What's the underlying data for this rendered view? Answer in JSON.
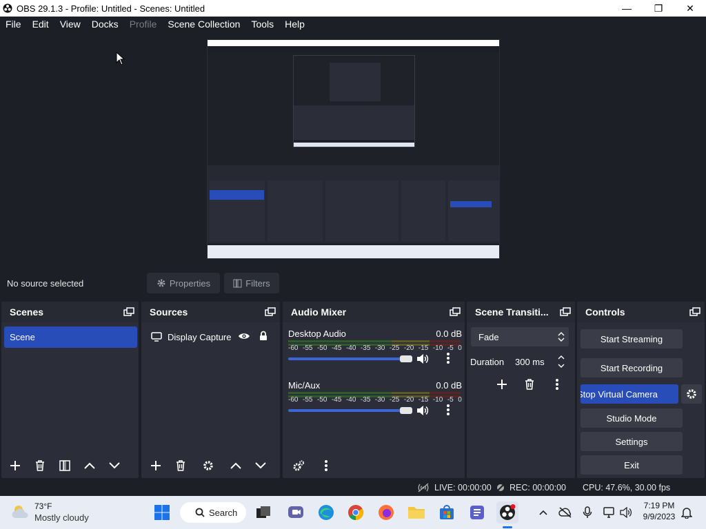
{
  "window": {
    "title": "OBS 29.1.3 - Profile: Untitled - Scenes: Untitled",
    "minimize": "—",
    "maximize": "❐",
    "close": "✕"
  },
  "menubar": {
    "items": [
      {
        "label": "File",
        "enabled": true
      },
      {
        "label": "Edit",
        "enabled": true
      },
      {
        "label": "View",
        "enabled": true
      },
      {
        "label": "Docks",
        "enabled": true
      },
      {
        "label": "Profile",
        "enabled": false
      },
      {
        "label": "Scene Collection",
        "enabled": true
      },
      {
        "label": "Tools",
        "enabled": true
      },
      {
        "label": "Help",
        "enabled": true
      }
    ]
  },
  "sourcebar": {
    "no_source": "No source selected",
    "properties": "Properties",
    "filters": "Filters"
  },
  "scenes": {
    "title": "Scenes",
    "items": [
      "Scene"
    ]
  },
  "sources": {
    "title": "Sources",
    "items": [
      {
        "label": "Display Capture",
        "visible": true,
        "locked": true
      }
    ]
  },
  "audio_mixer": {
    "title": "Audio Mixer",
    "ticks": [
      "-60",
      "-55",
      "-50",
      "-45",
      "-40",
      "-35",
      "-30",
      "-25",
      "-20",
      "-15",
      "-10",
      "-5",
      "0"
    ],
    "channels": [
      {
        "name": "Desktop Audio",
        "db": "0.0 dB",
        "volume": 1.0
      },
      {
        "name": "Mic/Aux",
        "db": "0.0 dB",
        "volume": 1.0
      }
    ]
  },
  "transitions": {
    "title": "Scene Transiti...",
    "selected": "Fade",
    "duration_label": "Duration",
    "duration_value": "300 ms"
  },
  "controls": {
    "title": "Controls",
    "start_streaming": "Start Streaming",
    "start_recording": "Start Recording",
    "stop_virtual_camera": "Stop Virtual Camera",
    "studio_mode": "Studio Mode",
    "settings": "Settings",
    "exit": "Exit"
  },
  "status": {
    "live": "LIVE: 00:00:00",
    "rec": "REC: 00:00:00",
    "cpu": "CPU: 47.6%, 30.00 fps"
  },
  "taskbar": {
    "weather_temp": "73°F",
    "weather_desc": "Mostly cloudy",
    "search": "Search",
    "time": "7:19 PM",
    "date": "9/9/2023"
  },
  "colors": {
    "accent": "#284cb8",
    "panel": "#2b2e38",
    "background": "#1d1f26"
  }
}
